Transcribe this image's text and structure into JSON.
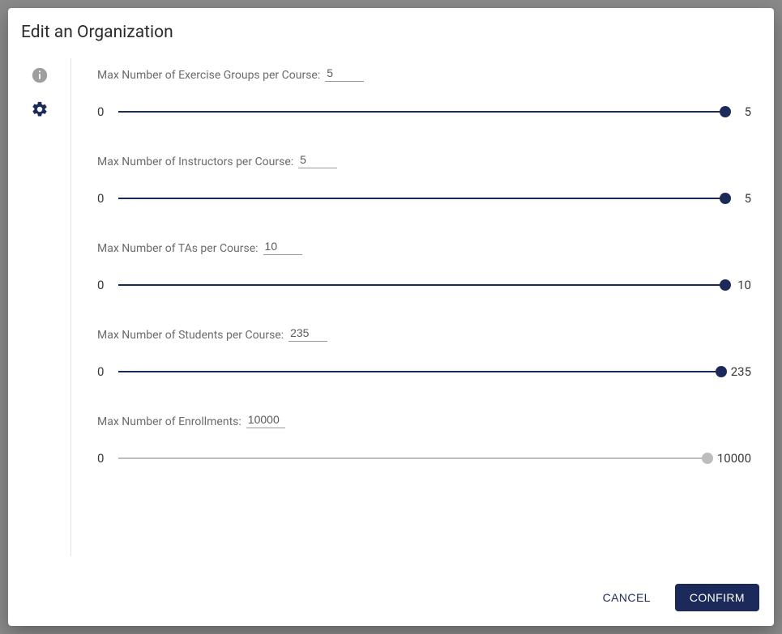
{
  "dialog": {
    "title": "Edit an Organization",
    "tabs": {
      "info": "info",
      "settings": "settings"
    },
    "fields": [
      {
        "label": "Max Number of Exercise Groups per Course:",
        "value": "5",
        "min": "0",
        "max": "5",
        "pct": 100,
        "disabled": false
      },
      {
        "label": "Max Number of Instructors per Course:",
        "value": "5",
        "min": "0",
        "max": "5",
        "pct": 100,
        "disabled": false
      },
      {
        "label": "Max Number of TAs per Course:",
        "value": "10",
        "min": "0",
        "max": "10",
        "pct": 100,
        "disabled": false
      },
      {
        "label": "Max Number of Students per Course:",
        "value": "235",
        "min": "0",
        "max": "235",
        "pct": 100,
        "disabled": false
      },
      {
        "label": "Max Number of Enrollments:",
        "value": "10000",
        "min": "0",
        "max": "10000",
        "pct": 100,
        "disabled": true
      }
    ],
    "actions": {
      "cancel": "Cancel",
      "confirm": "Confirm"
    }
  }
}
